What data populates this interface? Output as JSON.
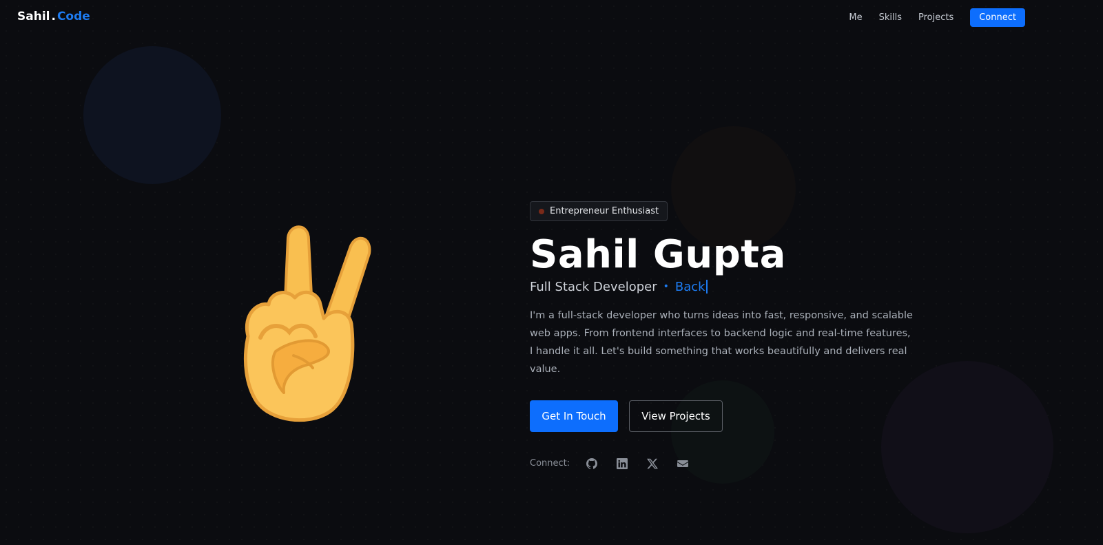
{
  "nav": {
    "logo_first": "Sahil",
    "logo_dot": ".",
    "logo_second": "Code",
    "links": [
      "Me",
      "Skills",
      "Projects"
    ],
    "cta": "Connect"
  },
  "hero": {
    "emoji_icon": "victory-hand-icon",
    "badge": "Entrepreneur Enthusiast",
    "name": "Sahil Gupta",
    "role": "Full Stack Developer",
    "role_separator": "•",
    "typed_text": "Back",
    "description": "I'm a full-stack developer who turns ideas into fast, responsive, and scalable web apps. From frontend interfaces to backend logic and real-time features, I handle it all. Let's build something that works beautifully and delivers real value.",
    "primary_button": "Get In Touch",
    "secondary_button": "View Projects",
    "connect_label": "Connect:",
    "socials": [
      "github-icon",
      "linkedin-icon",
      "x-icon",
      "mail-icon"
    ]
  },
  "colors": {
    "background": "#0b0c10",
    "accent": "#0d6efd",
    "badge_dot": "#7a2a19"
  }
}
